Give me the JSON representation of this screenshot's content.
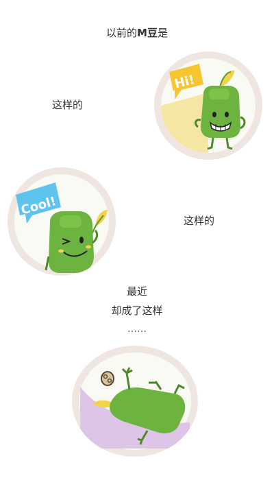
{
  "intro": {
    "prefix": "以前的",
    "brand": "M豆",
    "suffix": "是"
  },
  "caption_1": "这样的",
  "caption_2": "这样的",
  "recent": "最近",
  "became": "却成了这样",
  "ellipsis": "……",
  "bubble_1": "Hi!",
  "bubble_2": "Cool!",
  "colors": {
    "ring": "#efe6e1",
    "bean_green": "#6db33f",
    "leaf_yellow": "#f3d34a",
    "bubble_yellow": "#f6c531",
    "bubble_blue": "#5ec3ef",
    "purple_bg": "#dcc5e6",
    "pale_yellow_bg": "#f6e6a3"
  }
}
